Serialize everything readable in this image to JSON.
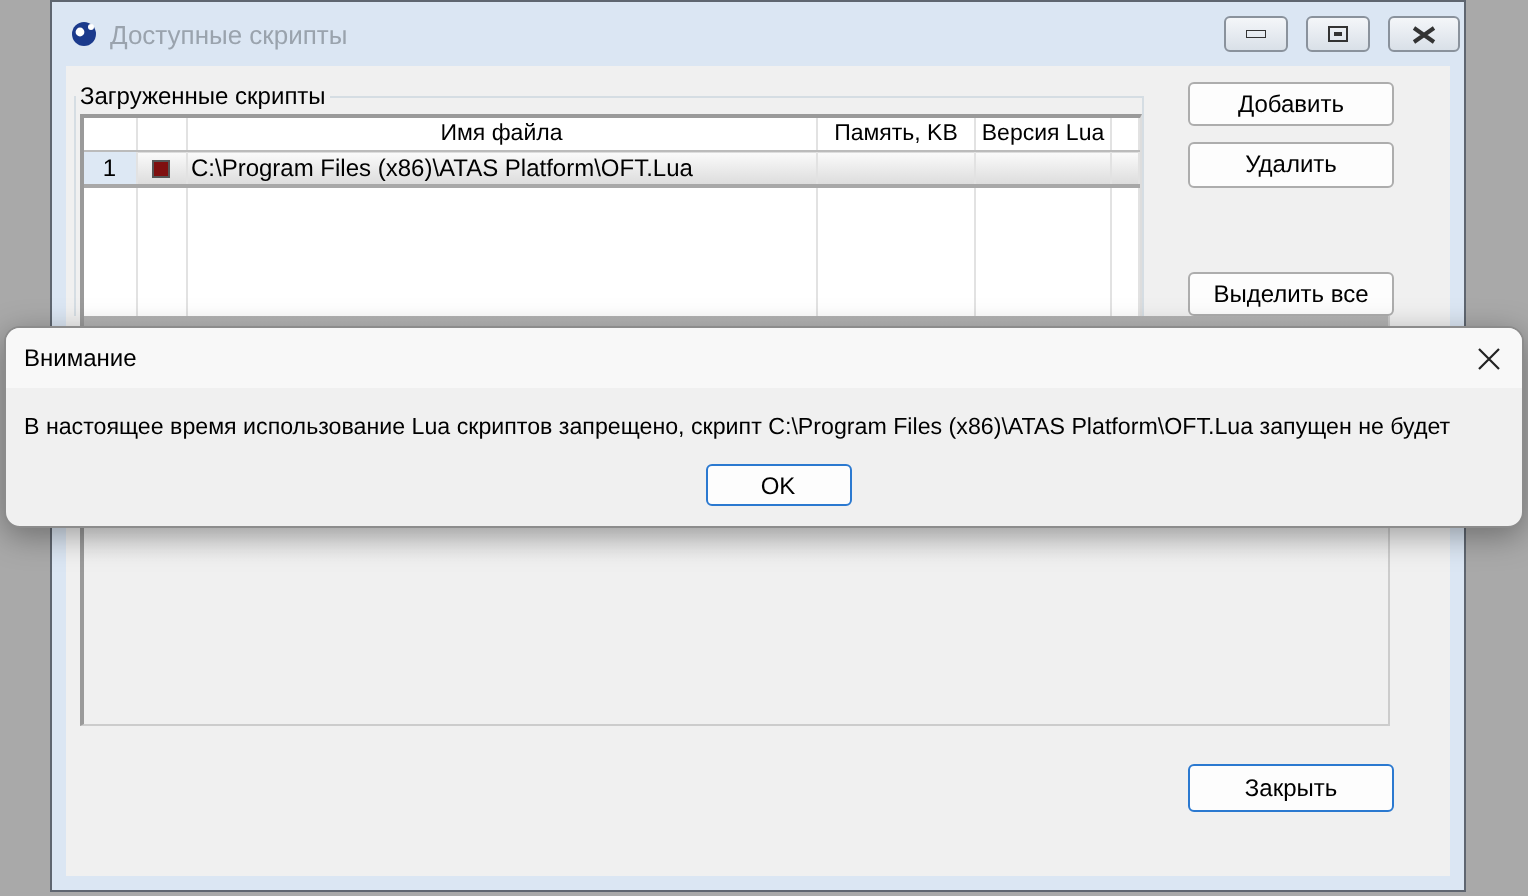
{
  "window": {
    "title": "Доступные скрипты"
  },
  "group": {
    "title": "Загруженные скрипты"
  },
  "table": {
    "columns": [
      "Имя файла",
      "Память, KB",
      "Версия Lua"
    ],
    "rows": [
      {
        "number": "1",
        "color": "#7f0f0f",
        "file": "C:\\Program Files (x86)\\ATAS Platform\\OFT.Lua"
      }
    ]
  },
  "buttons": [
    "Добавить",
    "Удалить",
    "Выделить все"
  ],
  "close_button": "Закрыть",
  "dialog": {
    "title": "Внимание",
    "message": "В настоящее время использование Lua скриптов запрещено, скрипт C:\\Program Files (x86)\\ATAS Platform\\OFT.Lua запущен не будет",
    "button": "OK"
  }
}
